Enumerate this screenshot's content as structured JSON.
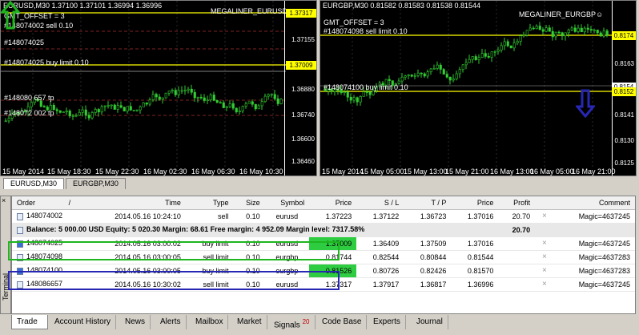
{
  "left_chart": {
    "title": "EURUSD,M30  1.37100 1.37101 1.36994 1.36996",
    "indicator": "MEGALINER_EURUSD☺",
    "grid_label": "GMT_OFFSET = 3",
    "prices": [
      "1.37317",
      "1.37155",
      "1.37009",
      "1.36880",
      "1.36740",
      "1.36600",
      "1.36460"
    ],
    "current_price": "1.37317",
    "order_line_price": "1.37009",
    "order_labels": [
      "#148074002 sell 0.10",
      "#148074025",
      "#148074025 buy limit 0.10",
      "#148080 657 tp",
      "#148072 002 tp"
    ],
    "times": [
      "15 May 2014",
      "15 May 18:30",
      "15 May 22:30",
      "16 May 02:30",
      "16 May 06:30",
      "16 May 10:30"
    ]
  },
  "right_chart": {
    "title": "EURGBP,M30  0.81582 0.81583 0.81538 0.81544",
    "indicator": "MEGALINER_EURGBP☺",
    "grid_label": "GMT_OFFSET = 3",
    "prices": [
      "0.8174",
      "0.8163",
      "0.8152",
      "0.8141",
      "0.8130",
      "0.8125"
    ],
    "top_line_price": "0.8174",
    "order_line_price": "0.8152",
    "current_price": "0.8154",
    "order_labels": [
      "#148074098 sell limit 0.10",
      "#148074100 buy limit 0.10"
    ],
    "times": [
      "15 May 2014",
      "15 May 05:00",
      "15 May 13:00",
      "15 May 21:00",
      "16 May 13:00",
      "16 May 05:00",
      "16 May 21:00"
    ]
  },
  "chart_tabs": [
    "EURUSD,M30",
    "EURGBP,M30"
  ],
  "terminal": {
    "vertical_label": "Terminal",
    "close": "×",
    "columns": [
      "Order",
      "/",
      "Time",
      "Type",
      "Size",
      "Symbol",
      "Price",
      "S / L",
      "T / P",
      "Price",
      "Profit",
      "",
      "Comment"
    ],
    "rows": [
      {
        "order": "148074002",
        "time": "2014.05.16 10:24:10",
        "type": "sell",
        "size": "0.10",
        "symbol": "eurusd",
        "price": "1.37223",
        "sl": "1.37122",
        "tp": "1.36723",
        "cur": "1.37016",
        "profit": "20.70",
        "x": "×",
        "comment": "Magic=4637245"
      },
      {
        "order": "148074025",
        "time": "2014.05.16 03:00:02",
        "type": "buy limit",
        "size": "0.10",
        "symbol": "eurusd",
        "price": "1.37009",
        "sl": "1.36409",
        "tp": "1.37509",
        "cur": "1.37016",
        "profit": "",
        "x": "×",
        "comment": "Magic=4637245"
      },
      {
        "order": "148074098",
        "time": "2014.05.16 03:00:05",
        "type": "sell limit",
        "size": "0.10",
        "symbol": "eurgbp",
        "price": "0.81744",
        "sl": "0.82544",
        "tp": "0.80844",
        "cur": "0.81544",
        "profit": "",
        "x": "×",
        "comment": "Magic=4637283"
      },
      {
        "order": "148074100",
        "time": "2014.05.16 03:00:05",
        "type": "buy limit",
        "size": "0.10",
        "symbol": "eurgbp",
        "price": "0.81526",
        "sl": "0.80726",
        "tp": "0.82426",
        "cur": "0.81570",
        "profit": "",
        "x": "×",
        "comment": "Magic=4637283"
      },
      {
        "order": "148086657",
        "time": "2014.05.16 10:30:02",
        "type": "sell limit",
        "size": "0.10",
        "symbol": "eurusd",
        "price": "1.37317",
        "sl": "1.37917",
        "tp": "1.36817",
        "cur": "1.36996",
        "profit": "",
        "x": "×",
        "comment": "Magic=4637245"
      }
    ],
    "balance_text": "Balance: 5 000.00 USD  Equity: 5 020.30  Margin: 68.61  Free margin: 4 952.09  Margin level: 7317.58%",
    "balance_profit": "20.70",
    "tabs": [
      "Trade",
      "Account History",
      "News",
      "Alerts",
      "Mailbox",
      "Market",
      "Signals",
      "Code Base",
      "Experts",
      "Journal"
    ],
    "signals_badge": "20"
  },
  "colors": {
    "chart_bg": "#000000",
    "candle": "#32cd32",
    "level_line": "#ffff00",
    "highlight_green": "#1fb51f",
    "highlight_blue": "#2727b4"
  }
}
